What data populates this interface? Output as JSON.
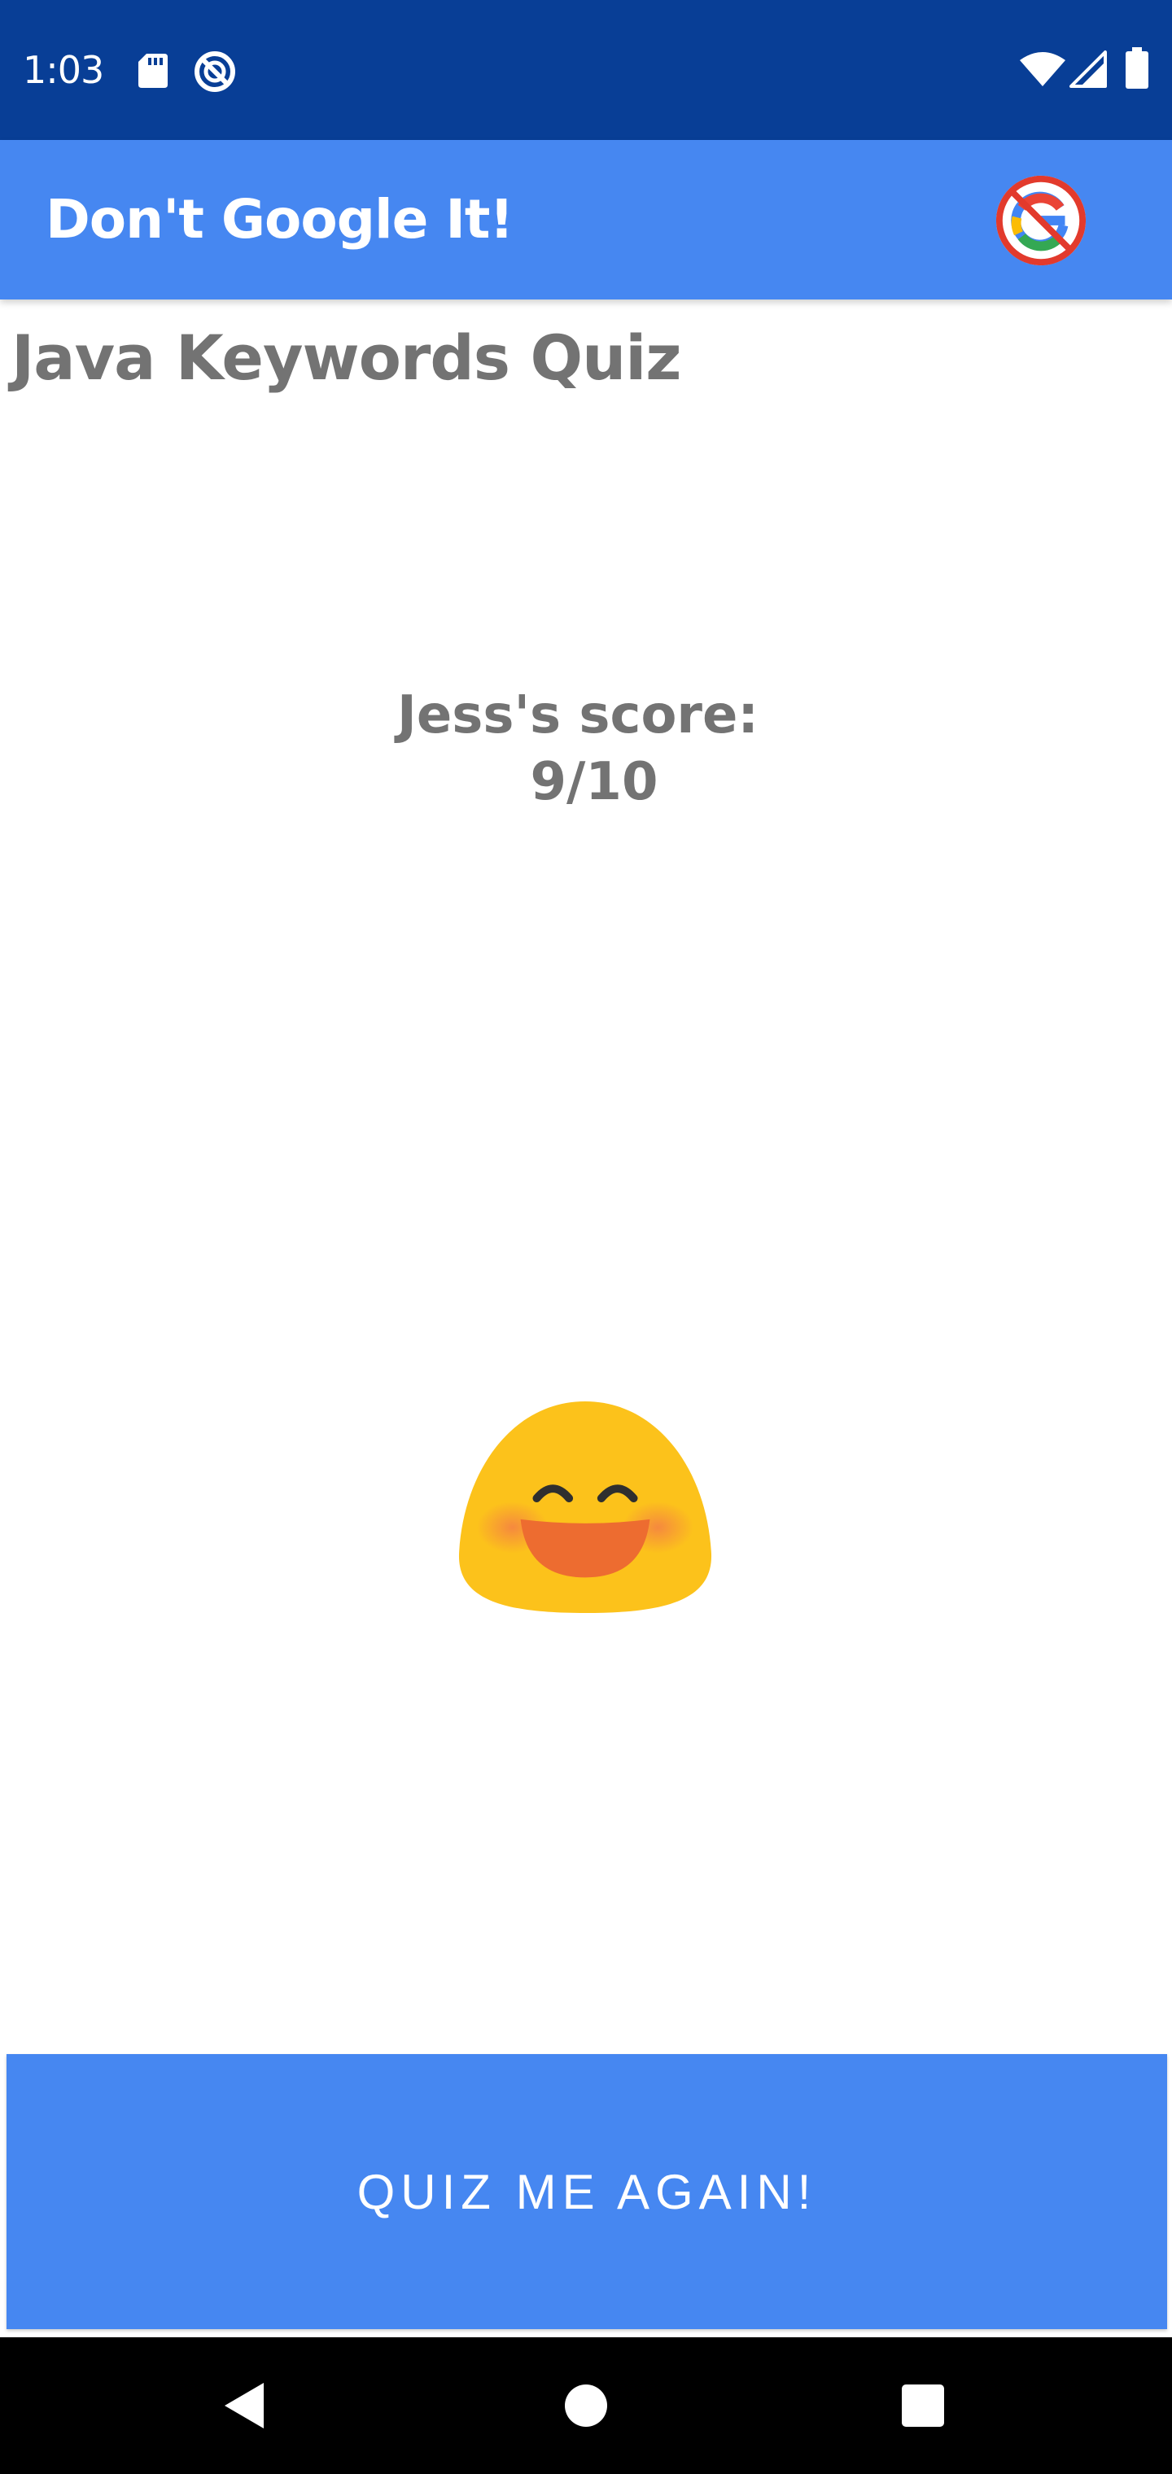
{
  "status_bar": {
    "time": "1:03",
    "icons": [
      "sd-card-icon",
      "do-not-disturb-icon",
      "wifi-icon",
      "cell-signal-icon",
      "battery-icon"
    ]
  },
  "app_bar": {
    "title": "Don't Google It!",
    "logo_icon": "no-google-logo-icon"
  },
  "quiz": {
    "title": "Java Keywords Quiz",
    "score_label": "Jess's score:",
    "score_value": "9/10",
    "emoji_icon": "smiling-face-emoji-icon"
  },
  "actions": {
    "quiz_again_label": "QUIZ ME AGAIN!"
  },
  "nav_bar": {
    "icons": [
      "back-icon",
      "home-icon",
      "recents-icon"
    ]
  },
  "colors": {
    "status_bar": "#083e96",
    "app_bar": "#4687f1",
    "button": "#4687f1",
    "text_gray": "#737373"
  }
}
